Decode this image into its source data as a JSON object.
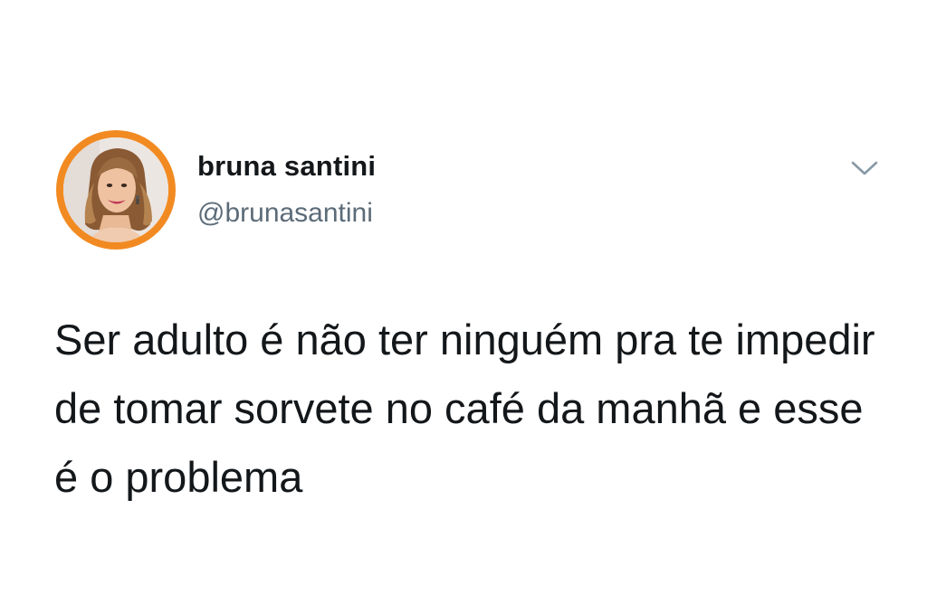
{
  "tweet": {
    "author": {
      "display_name": "bruna santini",
      "handle": "@brunasantini"
    },
    "text": "Ser adulto é não ter ninguém pra te impedir de tomar sorvete no café da manhã e esse é o problema",
    "menu_icon": "chevron-down-icon"
  },
  "colors": {
    "avatar_ring": "#f28a22",
    "name": "#14171a",
    "handle": "#5b6b78",
    "chevron": "#8899a6"
  }
}
